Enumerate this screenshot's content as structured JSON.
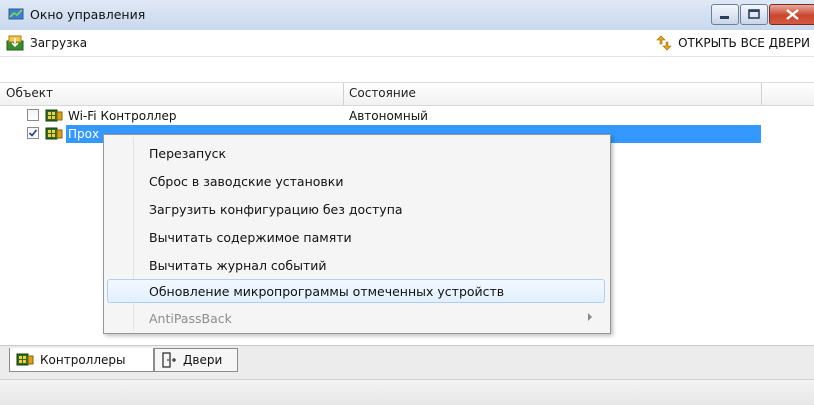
{
  "window": {
    "title": "Окно управления",
    "app_icon": "graph-icon"
  },
  "toolbar": {
    "load_label": "Загрузка",
    "load_icon": "download-icon",
    "open_doors_label": "ОТКРЫТЬ ВСЕ ДВЕРИ",
    "open_doors_icon": "arrows-updown-icon"
  },
  "grid": {
    "columns": [
      "Объект",
      "Состояние"
    ],
    "rows": [
      {
        "checked": false,
        "icon": "controller-icon",
        "name": "Wi-Fi Контроллер",
        "state": "Автономный",
        "selected": false
      },
      {
        "checked": true,
        "icon": "controller-icon",
        "name": "Прох",
        "state": "",
        "selected": true
      }
    ]
  },
  "context_menu": {
    "items": [
      {
        "label": "Перезапуск",
        "enabled": true
      },
      {
        "label": "Сброс в заводские установки",
        "enabled": true
      },
      {
        "label": "Загрузить конфигурацию без доступа",
        "enabled": true
      },
      {
        "label": "Вычитать содержимое памяти",
        "enabled": true
      },
      {
        "label": "Вычитать журнал событий",
        "enabled": true
      },
      {
        "label": "Обновление микропрограммы отмеченных устройств",
        "enabled": true,
        "highlighted": true
      },
      {
        "label": "AntiPassBack",
        "enabled": false,
        "submenu": true
      }
    ]
  },
  "tabs": [
    {
      "label": "Контроллеры",
      "icon": "controller-icon",
      "active": true
    },
    {
      "label": "Двери",
      "icon": "door-icon",
      "active": false
    }
  ],
  "colors": {
    "selection": "#3399ff",
    "menu_highlight": "#e3efff",
    "close_button": "#c9462e"
  }
}
